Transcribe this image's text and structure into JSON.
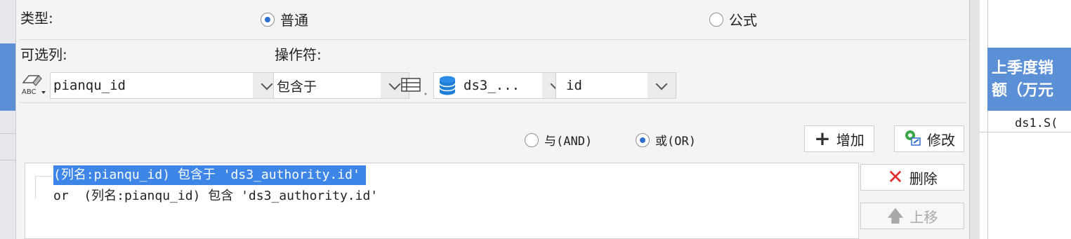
{
  "type_label": "类型:",
  "type_options": {
    "normal": "普通",
    "formula": "公式"
  },
  "type_selected": "normal",
  "column_label": "可选列:",
  "operator_label": "操作符:",
  "column_value": "pianqu_id",
  "operator_value": "包含于",
  "dataset_value": "ds3_...",
  "field_value": "id",
  "logic": {
    "and": "与(AND)",
    "or": "或(OR)",
    "selected": "or"
  },
  "buttons": {
    "add": "增加",
    "modify": "修改",
    "delete": "删除",
    "move_up": "上移"
  },
  "conditions": [
    {
      "text": "(列名:pianqu_id) 包含于 'ds3_authority.id'",
      "selected": true
    },
    {
      "text": "or  (列名:pianqu_id) 包含 'ds3_authority.id'",
      "selected": false
    }
  ],
  "background": {
    "header_text": "上季度销\n额（万元",
    "cell_text": "ds1.S("
  },
  "colors": {
    "accent": "#2f6fd0",
    "selection": "#3d86e8",
    "header_blue": "#5b8fd6",
    "delete_red": "#e03030"
  }
}
